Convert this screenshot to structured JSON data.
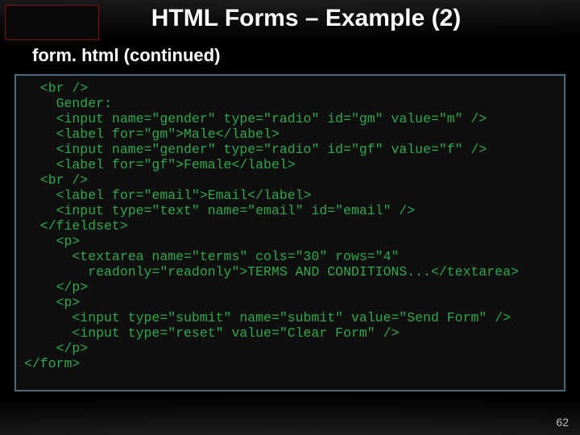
{
  "title": "HTML Forms – Example (2)",
  "subtitle": "form. html (continued)",
  "page_number": "62",
  "code_lines": [
    "  <br />",
    "    Gender:",
    "    <input name=\"gender\" type=\"radio\" id=\"gm\" value=\"m\" />",
    "    <label for=\"gm\">Male</label>",
    "    <input name=\"gender\" type=\"radio\" id=\"gf\" value=\"f\" />",
    "    <label for=\"gf\">Female</label>",
    "  <br />",
    "    <label for=\"email\">Email</label>",
    "    <input type=\"text\" name=\"email\" id=\"email\" />",
    "  </fieldset>",
    "    <p>",
    "      <textarea name=\"terms\" cols=\"30\" rows=\"4\"",
    "        readonly=\"readonly\">TERMS AND CONDITIONS...</textarea>",
    "    </p>",
    "    <p>",
    "      <input type=\"submit\" name=\"submit\" value=\"Send Form\" />",
    "      <input type=\"reset\" value=\"Clear Form\" />",
    "    </p>",
    "</form>"
  ]
}
